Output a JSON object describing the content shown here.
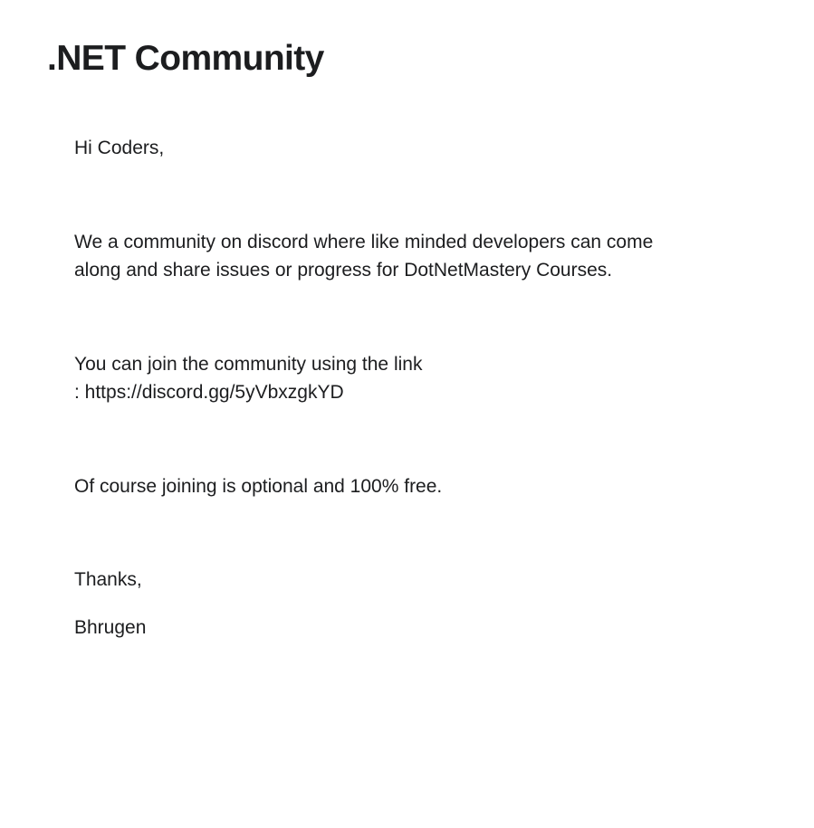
{
  "page": {
    "title": ".NET Community"
  },
  "message": {
    "greeting": "Hi Coders,",
    "paragraph1": {
      "line1": "We a community on discord where like minded developers can come",
      "line2": "along and share issues or progress for DotNetMastery Courses."
    },
    "paragraph2": {
      "line1": "You can join the community using the link",
      "line2": ": https://discord.gg/5yVbxzgkYD"
    },
    "paragraph3": "Of course joining is optional and 100% free.",
    "closing": "Thanks,",
    "signature": "Bhrugen"
  }
}
